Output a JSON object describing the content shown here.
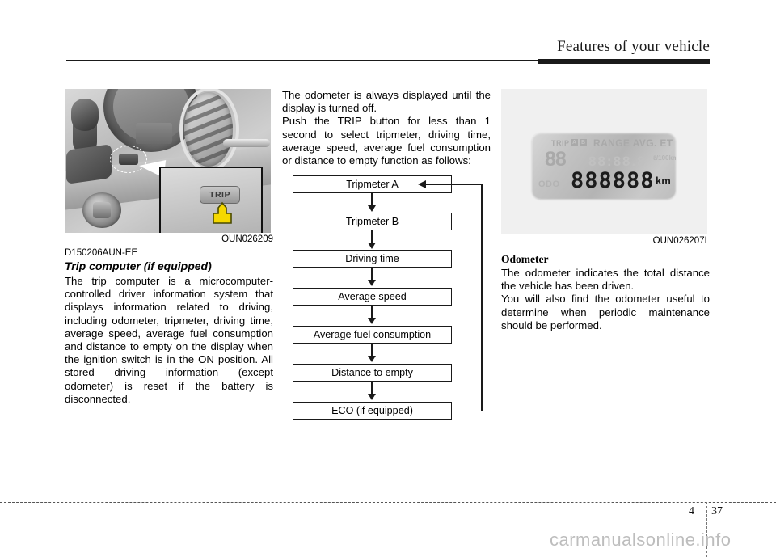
{
  "header": {
    "title": "Features of your vehicle"
  },
  "left_column": {
    "figure_caption": "OUN026209",
    "photo": {
      "callout_button_label": "TRIP"
    },
    "doc_id": "D150206AUN-EE",
    "subheading": "Trip computer (if equipped)",
    "paragraph": "The trip computer is a microcomputer-controlled driver information system that displays information related to driving, including odometer, tripmeter, driving time, average speed, average fuel consumption and distance to empty on the display when the ignition switch is in the ON position. All stored driving information (except odometer) is reset if the battery is disconnected."
  },
  "middle_column": {
    "paragraph_1": "The odometer is always displayed until the display is turned off.",
    "paragraph_2": "Push the TRIP button for less than 1 second to select tripmeter, driving time, average speed, average fuel consumption or distance to empty function as follows:",
    "flowchart": {
      "steps": [
        "Tripmeter A",
        "Tripmeter B",
        "Driving time",
        "Average speed",
        "Average fuel consumption",
        "Distance to empty",
        "ECO (if equipped)"
      ]
    }
  },
  "right_column": {
    "figure_caption": "OUN026207L",
    "lcd": {
      "trip_label": "TRIP",
      "trip_a": "A",
      "trip_b": "B",
      "range_label": "RANGE AVG. ET",
      "big_left_digits": "88",
      "mid_digits": "88:88.8",
      "units_label": "ℓ/100km/h",
      "odo_label": "ODO",
      "odo_digits": "888888",
      "odo_unit": "km"
    },
    "heading": "Odometer",
    "paragraph_1": "The odometer indicates the total distance the vehicle has been driven.",
    "paragraph_2": "You will also find the odometer useful to determine when periodic maintenance should be performed."
  },
  "footer": {
    "chapter": "4",
    "page": "37",
    "watermark": "carmanualsonline.info"
  }
}
